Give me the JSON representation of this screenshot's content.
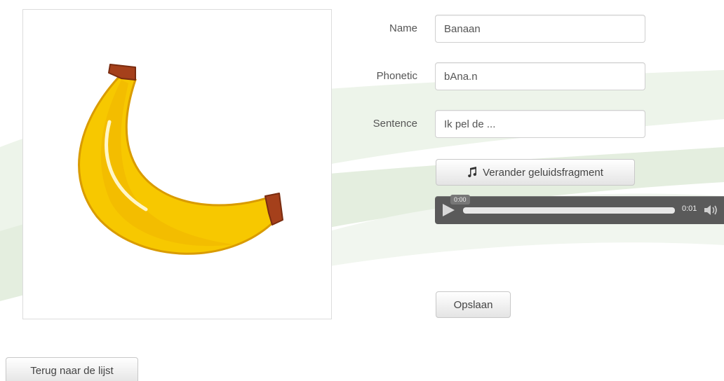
{
  "form": {
    "name_label": "Name",
    "name_value": "Banaan",
    "phonetic_label": "Phonetic",
    "phonetic_value": "bAna.n",
    "sentence_label": "Sentence",
    "sentence_value": "Ik pel de ..."
  },
  "buttons": {
    "change_sound_label": "Verander geluidsfragment",
    "change_sound_icon": "music-note-icon",
    "save_label": "Opslaan",
    "back_label": "Terug naar de lijst"
  },
  "audio_player": {
    "current_time": "0:00",
    "duration": "0:01",
    "progress": 1.0,
    "play_icon": "play-icon",
    "volume_icon": "volume-icon"
  },
  "image": {
    "subject_icon": "banana-icon"
  },
  "colors": {
    "banana_yellow": "#f7c800",
    "banana_stem": "#a5401b",
    "background_swoosh": "#e6f0e2",
    "player_bg": "#5a5a5a"
  }
}
